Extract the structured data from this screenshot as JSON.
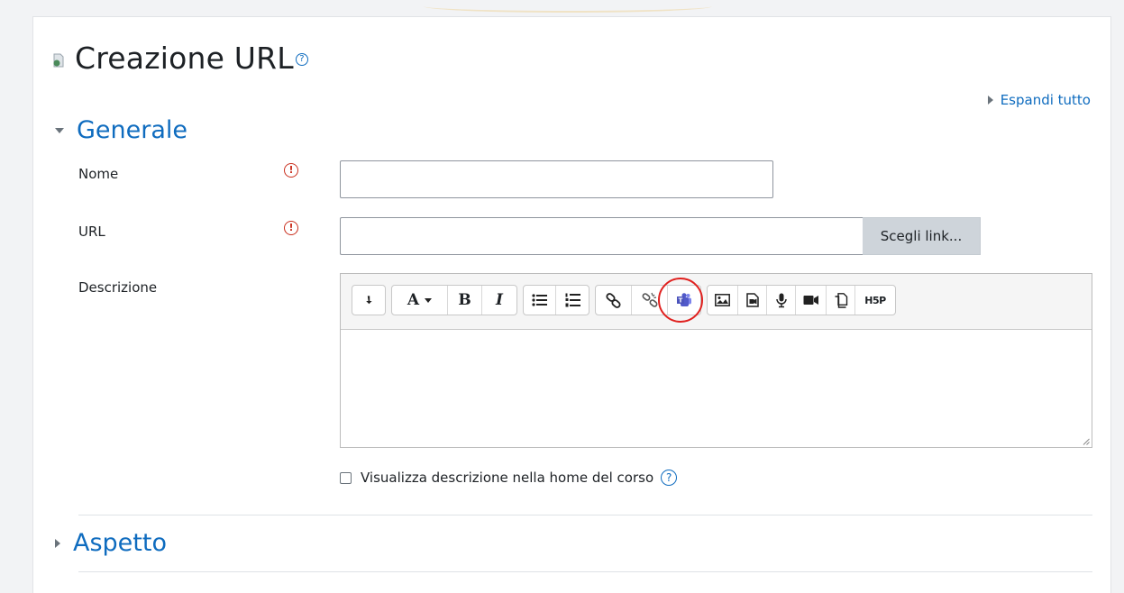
{
  "page": {
    "title": "Creazione URL",
    "title_help_glyph": "?",
    "expand_all_label": "Espandi tutto"
  },
  "sections": {
    "generale": {
      "label": "Generale",
      "expanded": true
    },
    "aspetto": {
      "label": "Aspetto",
      "expanded": false
    }
  },
  "fields": {
    "nome": {
      "label": "Nome",
      "value": "",
      "required": true,
      "required_glyph": "!"
    },
    "url": {
      "label": "URL",
      "value": "",
      "required": true,
      "required_glyph": "!",
      "button_label": "Scegli link..."
    },
    "descrizione": {
      "label": "Descrizione",
      "value": ""
    }
  },
  "editor": {
    "toolbar_groups": [
      [
        "collapse-icon"
      ],
      [
        "font-style-dropdown-icon",
        "bold-icon",
        "italic-icon"
      ],
      [
        "bulleted-list-icon",
        "numbered-list-icon"
      ],
      [
        "link-icon",
        "unlink-icon",
        "teams-meeting-icon"
      ],
      [
        "image-icon",
        "media-icon",
        "record-audio-icon",
        "record-video-icon",
        "manage-files-icon",
        "h5p-icon"
      ]
    ],
    "font_style_label": "A",
    "bold_label": "B",
    "italic_label": "I",
    "h5p_label": "H5P",
    "highlighted_button": "teams-meeting-icon"
  },
  "checkbox": {
    "label": "Visualizza descrizione nella home del corso",
    "checked": false,
    "help_glyph": "?"
  },
  "colors": {
    "accent": "#0f6cbf",
    "required": "#ca3120",
    "highlight_circle": "#e0211f",
    "teams": "#5059c9"
  }
}
